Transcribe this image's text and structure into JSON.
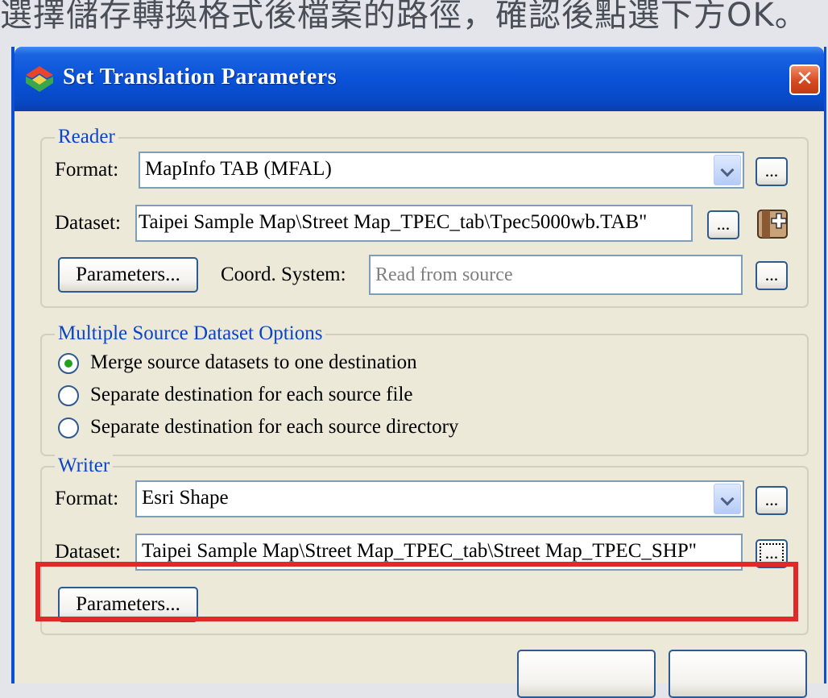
{
  "caption": "選擇儲存轉換格式後檔案的路徑，確認後點選下方OK。",
  "dialog": {
    "title": "Set Translation Parameters",
    "close_label": "✕"
  },
  "reader": {
    "group_label": "Reader",
    "format_label": "Format:",
    "format_value": "MapInfo TAB (MFAL)",
    "dataset_label": "Dataset:",
    "dataset_value": "Taipei Sample Map\\Street Map_TPEC_tab\\Tpec5000wb.TAB\"",
    "parameters_button": "Parameters...",
    "coord_label": "Coord. System:",
    "coord_value": "Read from source",
    "browse_label": "..."
  },
  "multiple_source": {
    "group_label": "Multiple Source Dataset Options",
    "options": [
      {
        "label": "Merge source datasets to one destination",
        "selected": true
      },
      {
        "label": "Separate destination for each source file",
        "selected": false
      },
      {
        "label": "Separate destination for each source directory",
        "selected": false
      }
    ]
  },
  "writer": {
    "group_label": "Writer",
    "format_label": "Format:",
    "format_value": "Esri Shape",
    "dataset_label": "Dataset:",
    "dataset_value": "Taipei Sample Map\\Street Map_TPEC_tab\\Street Map_TPEC_SHP\"",
    "parameters_button": "Parameters...",
    "browse_label": "..."
  },
  "colors": {
    "highlight": "#e02a2a",
    "titlebar": "#0a52d8",
    "group_label": "#0a44c8"
  }
}
